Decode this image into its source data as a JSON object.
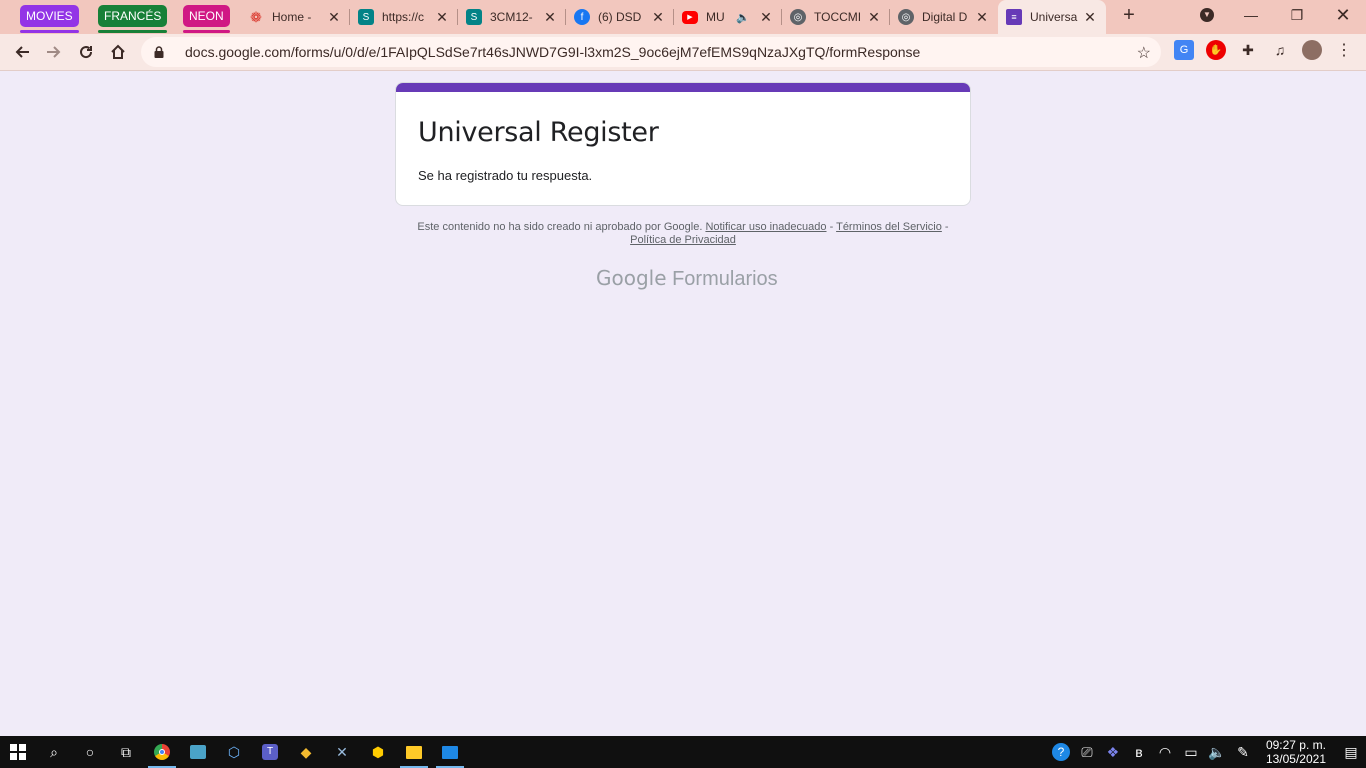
{
  "browser": {
    "tab_groups": [
      {
        "label": "MOVIES",
        "color": "#9334e6"
      },
      {
        "label": "FRANCÉS",
        "color": "#188038"
      },
      {
        "label": "NEON",
        "color": "#d01884"
      }
    ],
    "tabs": [
      {
        "title": "Home -",
        "icon": "maple-leaf-icon",
        "color": "#d93025"
      },
      {
        "title": "https://c",
        "icon": "sharepoint-icon",
        "color": "#038387"
      },
      {
        "title": "3CM12-",
        "icon": "sharepoint-icon",
        "color": "#038387"
      },
      {
        "title": "(6) DSD",
        "icon": "facebook-icon",
        "color": "#1877f2"
      },
      {
        "title": "MU",
        "icon": "youtube-icon",
        "color": "#ff0000"
      },
      {
        "title": "TOCCMI",
        "icon": "globe-icon",
        "color": "#5f6368"
      },
      {
        "title": "Digital D",
        "icon": "globe-icon",
        "color": "#5f6368"
      },
      {
        "title": "Universa",
        "icon": "google-forms-icon",
        "color": "#673ab7"
      }
    ],
    "url": "docs.google.com/forms/u/0/d/e/1FAIpQLSdSe7rt46sJNWD7G9I-l3xm2S_9oc6ejM7efEMS9qNzaJXgTQ/formResponse"
  },
  "form": {
    "title": "Universal Register",
    "message": "Se ha registrado tu respuesta."
  },
  "footer": {
    "disclaimer": "Este contenido no ha sido creado ni aprobado por Google.",
    "report_link": "Notificar uso inadecuado",
    "sep1": " - ",
    "terms_link": "Términos del Servicio",
    "sep2": " - ",
    "privacy_link": "Política de Privacidad",
    "brand_google": "Google",
    "brand_product": "Formularios"
  },
  "taskbar": {
    "time": "09:27 p. m.",
    "date": "13/05/2021"
  }
}
